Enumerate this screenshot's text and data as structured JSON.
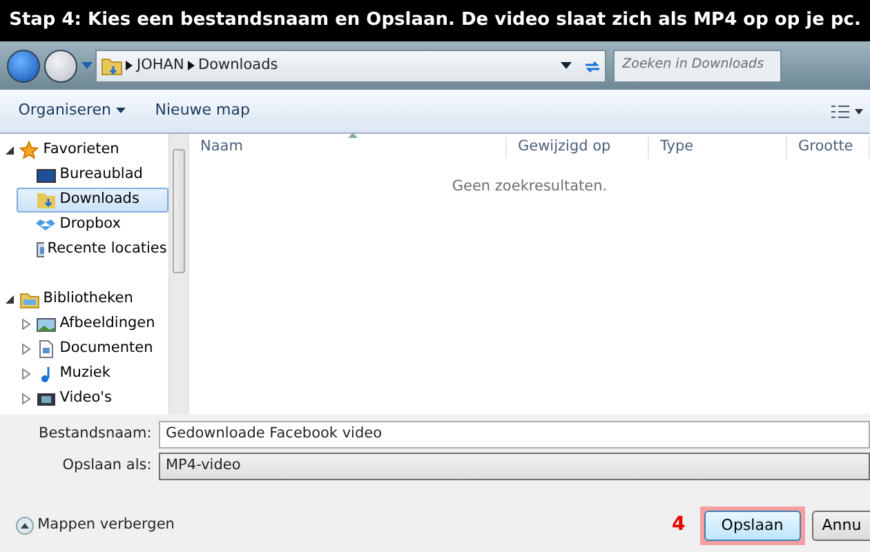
{
  "banner": {
    "title": "Stap 4: Kies een bestandsnaam en Opslaan. De video slaat zich als MP4 op op je pc."
  },
  "address_bar": {
    "path": [
      "JOHAN",
      "Downloads"
    ],
    "search_placeholder": "Zoeken in Downloads"
  },
  "toolbar": {
    "buttons": [
      {
        "label": "Organiseren",
        "dropdown": true
      },
      {
        "label": "Nieuwe map",
        "dropdown": false
      }
    ]
  },
  "sidebar": {
    "items": [
      {
        "label": "Favorieten",
        "expanded": true,
        "selected": false,
        "children": [
          {
            "label": "Bureaublad",
            "selected": false
          },
          {
            "label": "Downloads",
            "selected": true
          },
          {
            "label": "Dropbox",
            "selected": false
          },
          {
            "label": "Recente locaties",
            "selected": false
          }
        ]
      },
      {
        "label": "Bibliotheken",
        "expanded": true,
        "selected": false,
        "children": [
          {
            "label": "Afbeeldingen",
            "expanded": false,
            "selected": false
          },
          {
            "label": "Documenten",
            "expanded": false,
            "selected": false
          },
          {
            "label": "Muziek",
            "expanded": false,
            "selected": false
          },
          {
            "label": "Video's",
            "expanded": false,
            "selected": false
          }
        ]
      }
    ]
  },
  "file_list": {
    "columns": [
      {
        "label": "Naam",
        "sorted": true
      },
      {
        "label": "Gewijzigd op",
        "sorted": false
      },
      {
        "label": "Type",
        "sorted": false
      },
      {
        "label": "Grootte",
        "sorted": false
      }
    ],
    "empty_message": "Geen zoekresultaten."
  },
  "form": {
    "filename_label": "Bestandsnaam:",
    "filename": "Gedownloade Facebook video",
    "type_label": "Opslaan als:",
    "type": "MP4-video"
  },
  "footer": {
    "toggle_label": "Mappen verbergen",
    "step_number": "4",
    "buttons": [
      {
        "label": "Opslaan",
        "highlighted": true
      },
      {
        "label": "Annu",
        "highlighted": false
      }
    ]
  }
}
